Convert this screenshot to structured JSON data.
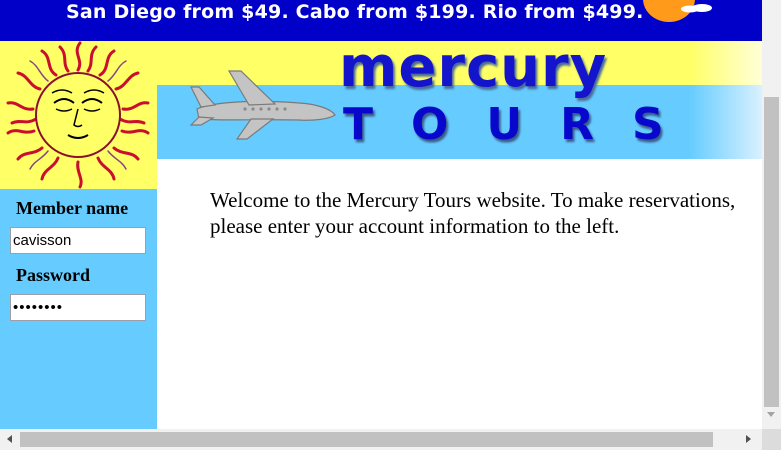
{
  "promo": {
    "text": "San Diego from $49. Cabo from $199. Rio from $499."
  },
  "brand": {
    "name_top": "mercury",
    "name_bottom": "TOURS"
  },
  "login": {
    "member_label": "Member name",
    "member_value": "cavisson",
    "password_label": "Password",
    "password_value": "••••••••"
  },
  "main": {
    "welcome_text": "Welcome to the Mercury Tours website. To make reservations, please enter your account information to the left."
  },
  "colors": {
    "promo_bg": "#0000c8",
    "sidebar_bg": "#66ccff",
    "header_yellow": "#ffff66",
    "brand_blue": "#1414cc"
  },
  "icons": {
    "sun": "sun-face-logo",
    "plane": "airplane-logo",
    "promo_sun": "sun-graphic"
  }
}
